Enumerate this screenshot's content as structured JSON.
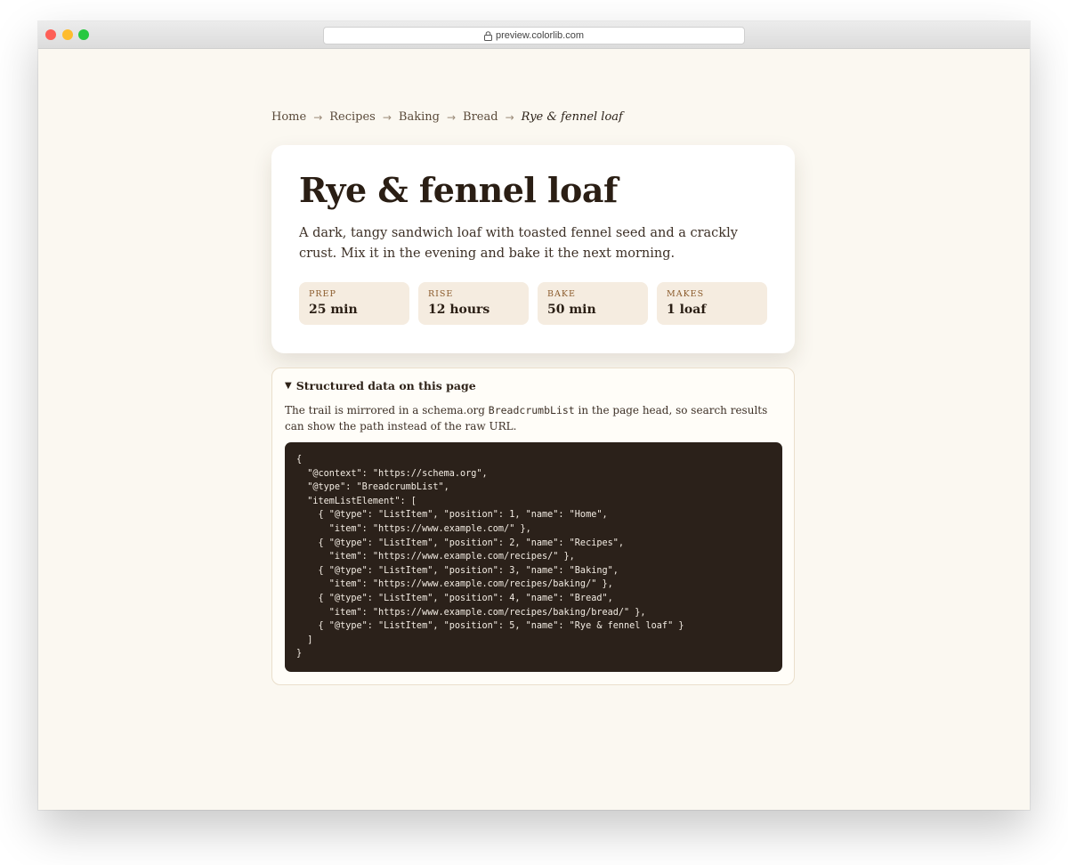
{
  "browser": {
    "url": "preview.colorlib.com"
  },
  "breadcrumb": {
    "items": [
      "Home",
      "Recipes",
      "Baking",
      "Bread"
    ],
    "separator": "→",
    "current": "Rye & fennel loaf"
  },
  "recipe": {
    "title": "Rye & fennel loaf",
    "description": "A dark, tangy sandwich loaf with toasted fennel seed and a crackly crust. Mix it in the evening and bake it the next morning.",
    "stats": [
      {
        "label": "PREP",
        "value": "25 min"
      },
      {
        "label": "RISE",
        "value": "12 hours"
      },
      {
        "label": "BAKE",
        "value": "50 min"
      },
      {
        "label": "MAKES",
        "value": "1 loaf"
      }
    ]
  },
  "structured": {
    "summary": "Structured data on this page",
    "note_before": "The trail is mirrored in a schema.org ",
    "note_code": "BreadcrumbList",
    "note_after": " in the page head, so search results can show the path instead of the raw URL.",
    "code": "{\n  \"@context\": \"https://schema.org\",\n  \"@type\": \"BreadcrumbList\",\n  \"itemListElement\": [\n    { \"@type\": \"ListItem\", \"position\": 1, \"name\": \"Home\",\n      \"item\": \"https://www.example.com/\" },\n    { \"@type\": \"ListItem\", \"position\": 2, \"name\": \"Recipes\",\n      \"item\": \"https://www.example.com/recipes/\" },\n    { \"@type\": \"ListItem\", \"position\": 3, \"name\": \"Baking\",\n      \"item\": \"https://www.example.com/recipes/baking/\" },\n    { \"@type\": \"ListItem\", \"position\": 4, \"name\": \"Bread\",\n      \"item\": \"https://www.example.com/recipes/baking/bread/\" },\n    { \"@type\": \"ListItem\", \"position\": 5, \"name\": \"Rye & fennel loaf\" }\n  ]\n}"
  },
  "colors": {
    "page_bg": "#fbf8f1",
    "card_bg": "#ffffff",
    "stat_bg": "#f5ece0",
    "code_bg": "#2b211a",
    "accent": "#8a5a2a"
  }
}
